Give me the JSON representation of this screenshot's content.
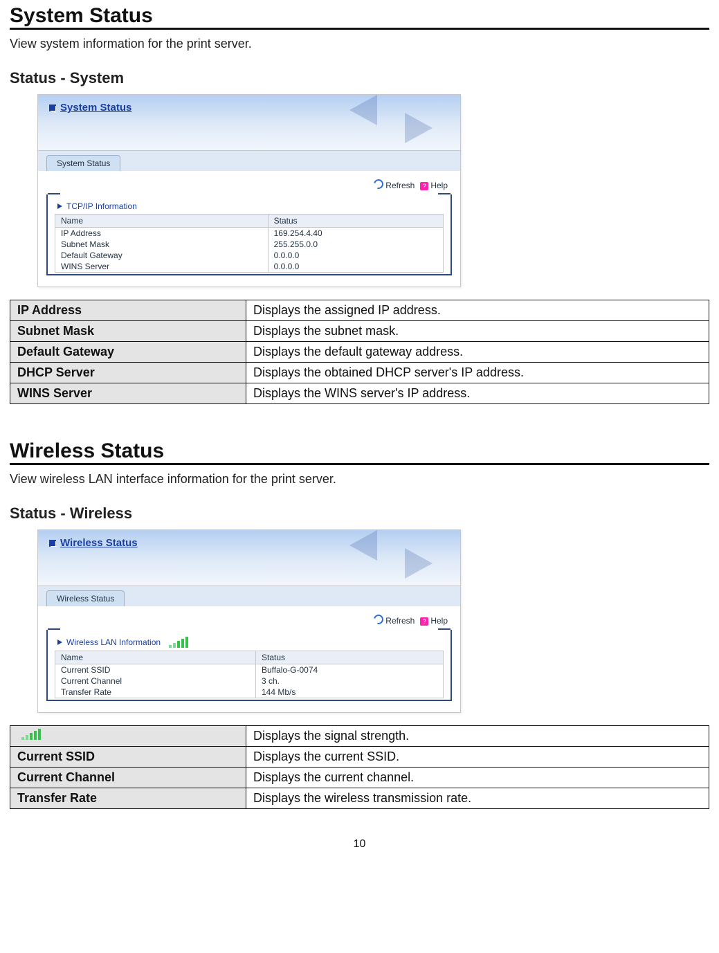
{
  "page_number": "10",
  "sections": [
    {
      "key": "system",
      "heading": "System Status",
      "lead": "View system information for the print server.",
      "sub": "Status - System",
      "shot": {
        "title": "System Status",
        "tab": "System Status",
        "actions": {
          "refresh": "Refresh",
          "help": "Help"
        },
        "group_title": "TCP/IP Information",
        "has_signal": false,
        "cols": [
          "Name",
          "Status"
        ],
        "rows": [
          {
            "name": "IP Address",
            "value": "169.254.4.40"
          },
          {
            "name": "Subnet Mask",
            "value": "255.255.0.0"
          },
          {
            "name": "Default Gateway",
            "value": "0.0.0.0"
          },
          {
            "name": "WINS Server",
            "value": "0.0.0.0"
          }
        ]
      },
      "desc": [
        {
          "label": "IP Address",
          "text": "Displays the assigned IP address."
        },
        {
          "label": "Subnet Mask",
          "text": "Displays the subnet mask."
        },
        {
          "label": "Default Gateway",
          "text": "Displays the default gateway address."
        },
        {
          "label": "DHCP Server",
          "text": "Displays the obtained DHCP server's IP address."
        },
        {
          "label": "WINS Server",
          "text": "Displays the WINS server's IP address."
        }
      ]
    },
    {
      "key": "wireless",
      "heading": "Wireless Status",
      "lead": "View wireless LAN interface information for the print server.",
      "sub": "Status - Wireless",
      "shot": {
        "title": "Wireless Status",
        "tab": "Wireless Status",
        "actions": {
          "refresh": "Refresh",
          "help": "Help"
        },
        "group_title": "Wireless LAN Information",
        "has_signal": true,
        "cols": [
          "Name",
          "Status"
        ],
        "rows": [
          {
            "name": "Current SSID",
            "value": "Buffalo-G-0074"
          },
          {
            "name": "Current Channel",
            "value": "3 ch."
          },
          {
            "name": "Transfer Rate",
            "value": "144 Mb/s"
          }
        ]
      },
      "desc": [
        {
          "icon": "signal",
          "label": "",
          "text": "Displays the signal strength."
        },
        {
          "label": "Current SSID",
          "text": "Displays the current SSID."
        },
        {
          "label": "Current Channel",
          "text": "Displays the current channel."
        },
        {
          "label": "Transfer Rate",
          "text": "Displays the wireless transmission rate."
        }
      ]
    }
  ]
}
